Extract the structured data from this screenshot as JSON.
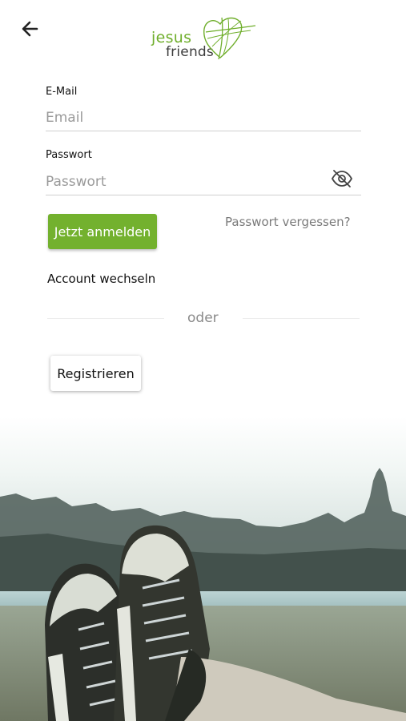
{
  "header": {
    "back_icon": "arrow-left-icon",
    "logo_text_1": "jesus",
    "logo_text_2": "friends",
    "logo_icon": "heart-cross-icon"
  },
  "form": {
    "email_label": "E-Mail",
    "email_placeholder": "Email",
    "email_value": "",
    "password_label": "Passwort",
    "password_placeholder": "Passwort",
    "password_value": "",
    "password_toggle_icon": "eye-off-icon",
    "login_button": "Jetzt anmelden",
    "forgot_link": "Passwort vergessen?",
    "switch_account": "Account wechseln",
    "divider_text": "oder",
    "register_button": "Registrieren"
  },
  "colors": {
    "accent": "#73b12e",
    "logo_green": "#6fae2b",
    "logo_dark": "#3d3d3d"
  },
  "background": {
    "description_icon": "sneakers-photo"
  }
}
